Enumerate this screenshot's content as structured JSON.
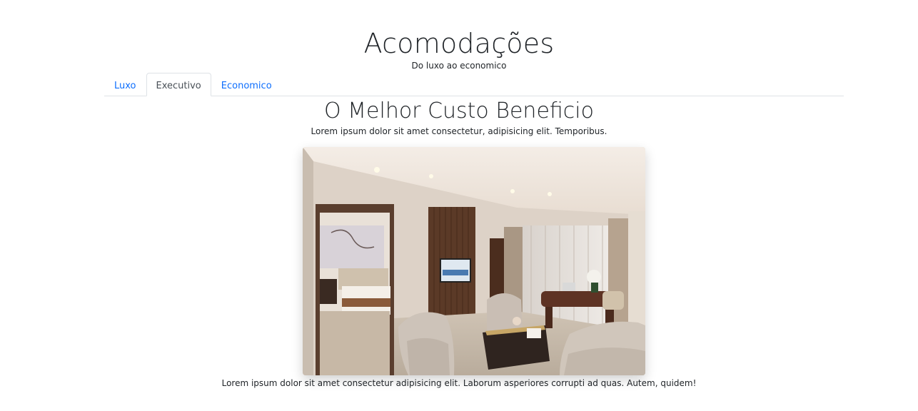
{
  "header": {
    "title": "Acomodações",
    "subtitle": "Do luxo ao economico"
  },
  "tabs": [
    {
      "label": "Luxo",
      "active": false
    },
    {
      "label": "Executivo",
      "active": true
    },
    {
      "label": "Economico",
      "active": false
    }
  ],
  "section": {
    "title": "O Melhor Custo Beneficio",
    "text": "Lorem ipsum dolor sit amet consectetur, adipisicing elit. Temporibus.",
    "caption": "Lorem ipsum dolor sit amet consectetur adipisicing elit. Laborum asperiores corrupti ad quas. Autem, quidem!"
  },
  "colors": {
    "link": "#0d6efd",
    "active_tab_text": "#495057",
    "border": "#dee2e6"
  }
}
